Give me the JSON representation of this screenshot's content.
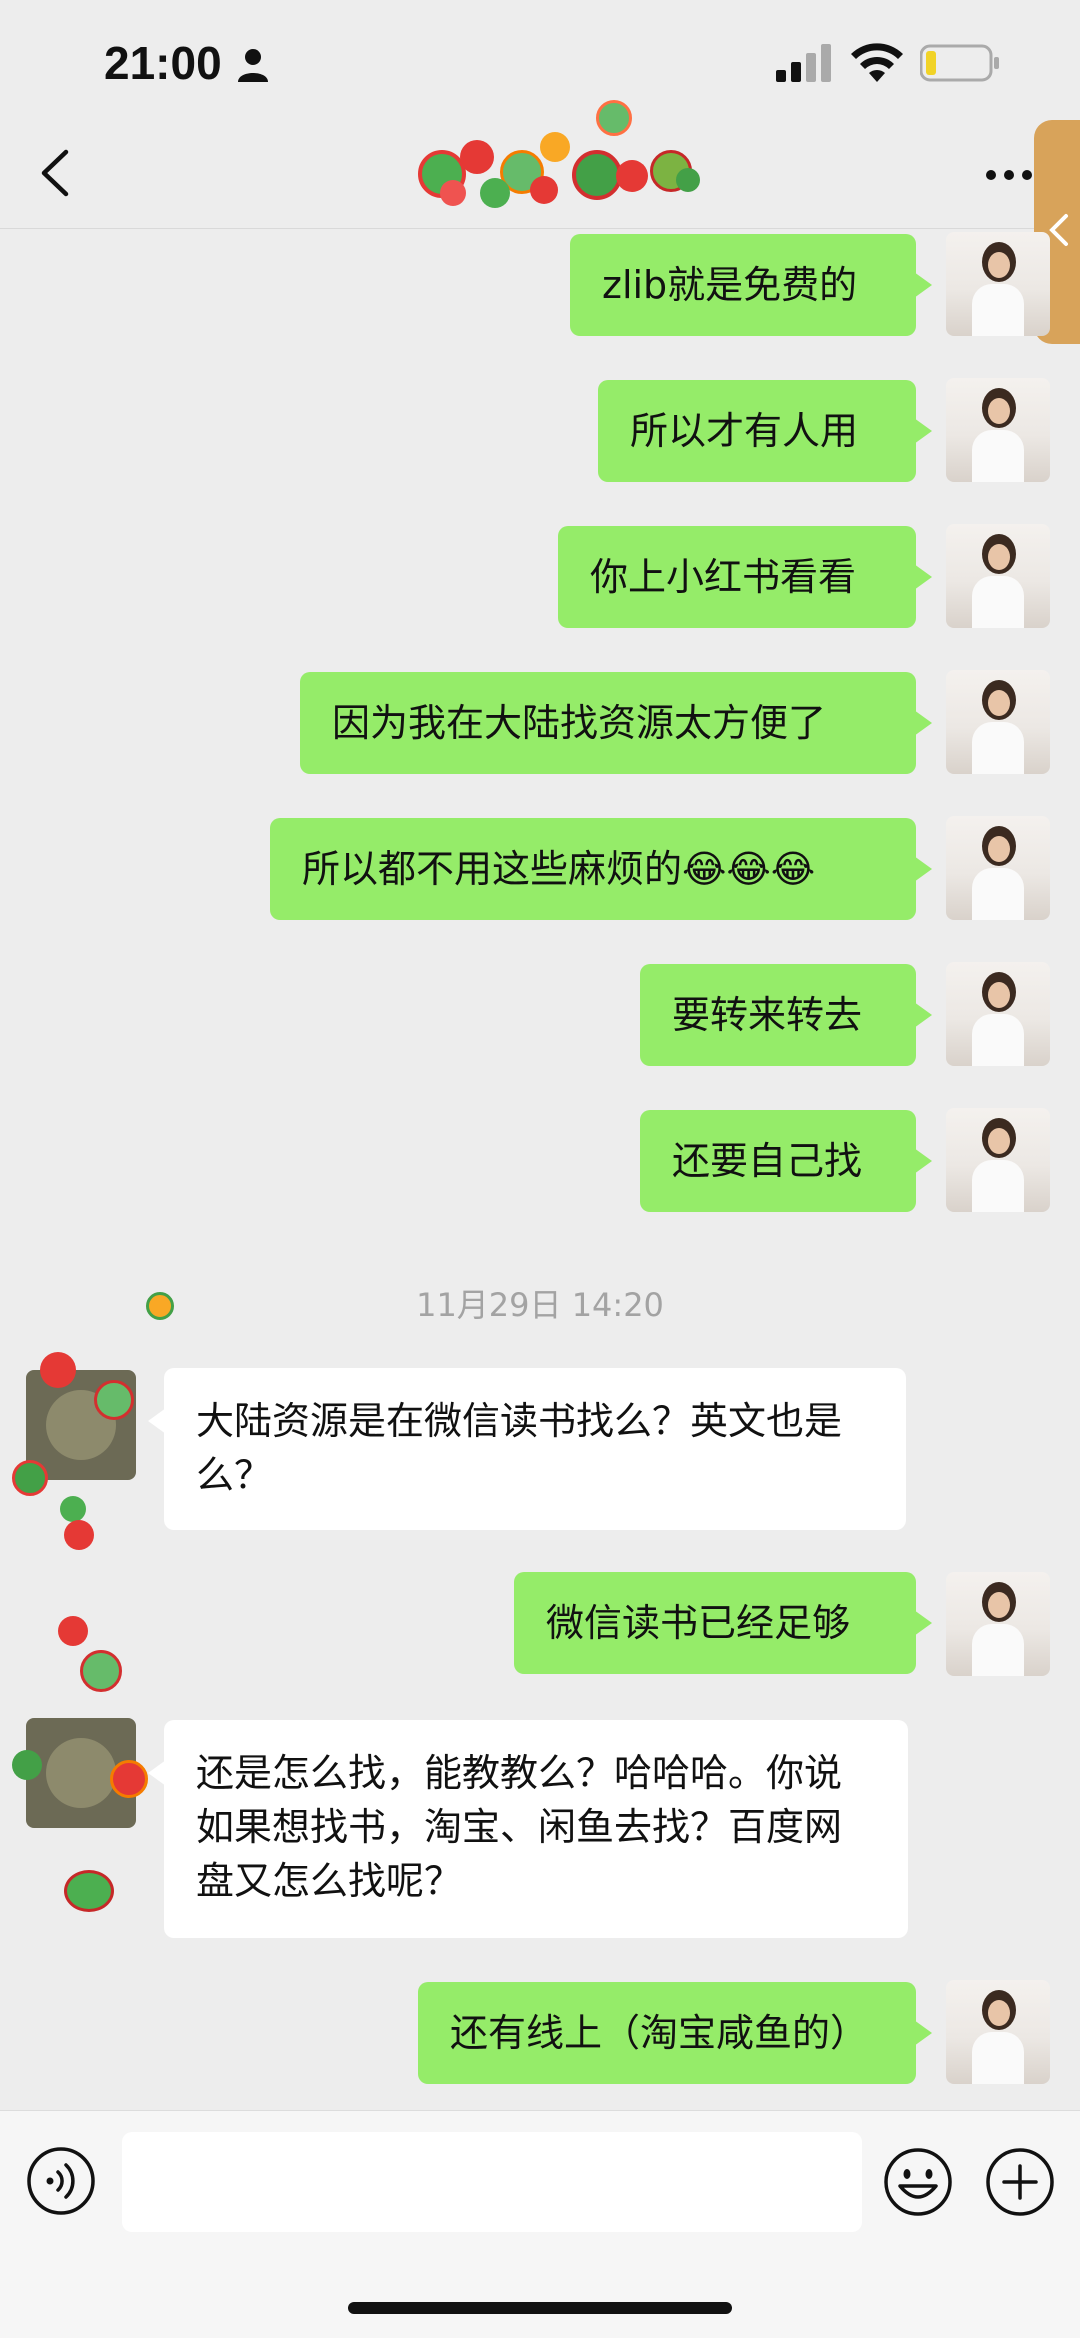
{
  "status_bar": {
    "time": "21:00"
  },
  "header": {
    "title": ""
  },
  "messages": [
    {
      "side": "out",
      "text": "zlib就是免费的"
    },
    {
      "side": "out",
      "text": "所以才有人用"
    },
    {
      "side": "out",
      "text": "你上小红书看看"
    },
    {
      "side": "out",
      "text": "因为我在大陆找资源太方便了"
    },
    {
      "side": "out",
      "text": "所以都不用这些麻烦的😂😂😂"
    },
    {
      "side": "out",
      "text": "要转来转去"
    },
    {
      "side": "out",
      "text": "还要自己找"
    },
    {
      "side": "in",
      "text": "大陆资源是在微信读书找么？英文也是么？"
    },
    {
      "side": "out",
      "text": "微信读书已经足够"
    },
    {
      "side": "in",
      "text": "还是怎么找，能教教么？哈哈哈。你说如果想找书，淘宝、闲鱼去找？百度网盘又怎么找呢？"
    },
    {
      "side": "out",
      "text": "还有线上（淘宝咸鱼的）"
    }
  ],
  "timestamp": "11月29日 14:20",
  "icons": {
    "back": "chevron-left-icon",
    "more": "more-dots-icon",
    "voice": "voice-icon",
    "emoji": "emoji-icon",
    "plus": "plus-icon"
  },
  "colors": {
    "out_bubble": "#95ec69",
    "in_bubble": "#ffffff",
    "background": "#ededed"
  }
}
